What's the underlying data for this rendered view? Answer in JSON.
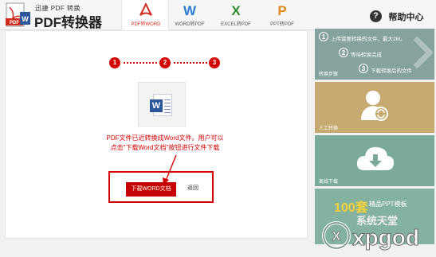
{
  "app": {
    "logo_small": "迅捷 PDF 转换",
    "logo_big": "PDF转换器",
    "logo_badge_text": "PDF"
  },
  "tabs": [
    {
      "icon": "adobe-pdf-icon",
      "glyph": "⅄",
      "label": "PDF转WORD",
      "color": "#d12b1f",
      "active": true
    },
    {
      "icon": "word-w-icon",
      "glyph": "W",
      "label": "WORD转PDF",
      "color": "#2b7cd3",
      "active": false
    },
    {
      "icon": "excel-x-icon",
      "glyph": "X",
      "label": "EXCEL转PDF",
      "color": "#2e8b30",
      "active": false
    },
    {
      "icon": "ppt-p-icon",
      "glyph": "P",
      "label": "PPT转PDF",
      "color": "#e08a1e",
      "active": false
    }
  ],
  "help": {
    "icon": "?",
    "label": "帮助中心"
  },
  "steps": [
    "1",
    "2",
    "3"
  ],
  "file_icon": "W",
  "message": {
    "line1": "PDF文件已近转换成Word文件。用户可以",
    "line2": "点击\"下载Word文档\"按钮进行文件下载"
  },
  "download_button": "下载WORD文档",
  "back_link": "返回",
  "side": {
    "card1": {
      "steps": [
        {
          "num": "1",
          "text": "上传需要转换的文件，最大2M。"
        },
        {
          "num": "2",
          "text": "等待转换完成"
        },
        {
          "num": "3",
          "text": "下载转换后的文件"
        }
      ],
      "caption": "转换步骤"
    },
    "card2": {
      "caption": "人工转换"
    },
    "card3": {
      "caption": "离线下载"
    },
    "card4": {
      "big": "100套",
      "small": "精品PPT模板",
      "sub": "系统天堂"
    }
  },
  "watermark": "xpgod",
  "colors": {
    "accent_red": "#d40000",
    "card1": "#86a29e",
    "card2": "#c7aa72",
    "card3": "#7aaa98",
    "card4": "#84b2a0"
  }
}
